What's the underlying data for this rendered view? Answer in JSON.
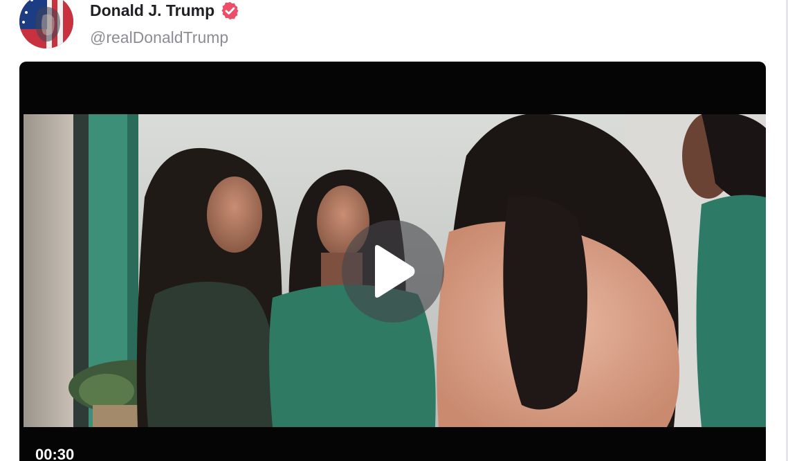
{
  "post": {
    "author_name": "Donald J. Trump",
    "handle": "@realDonaldTrump",
    "verified": true
  },
  "video": {
    "duration": "00:30",
    "controls": {
      "play_icon": "play-icon"
    }
  },
  "colors": {
    "verified_badge": "#ee4d67",
    "video_background": "#050505",
    "handle_text": "#8c8c95"
  }
}
